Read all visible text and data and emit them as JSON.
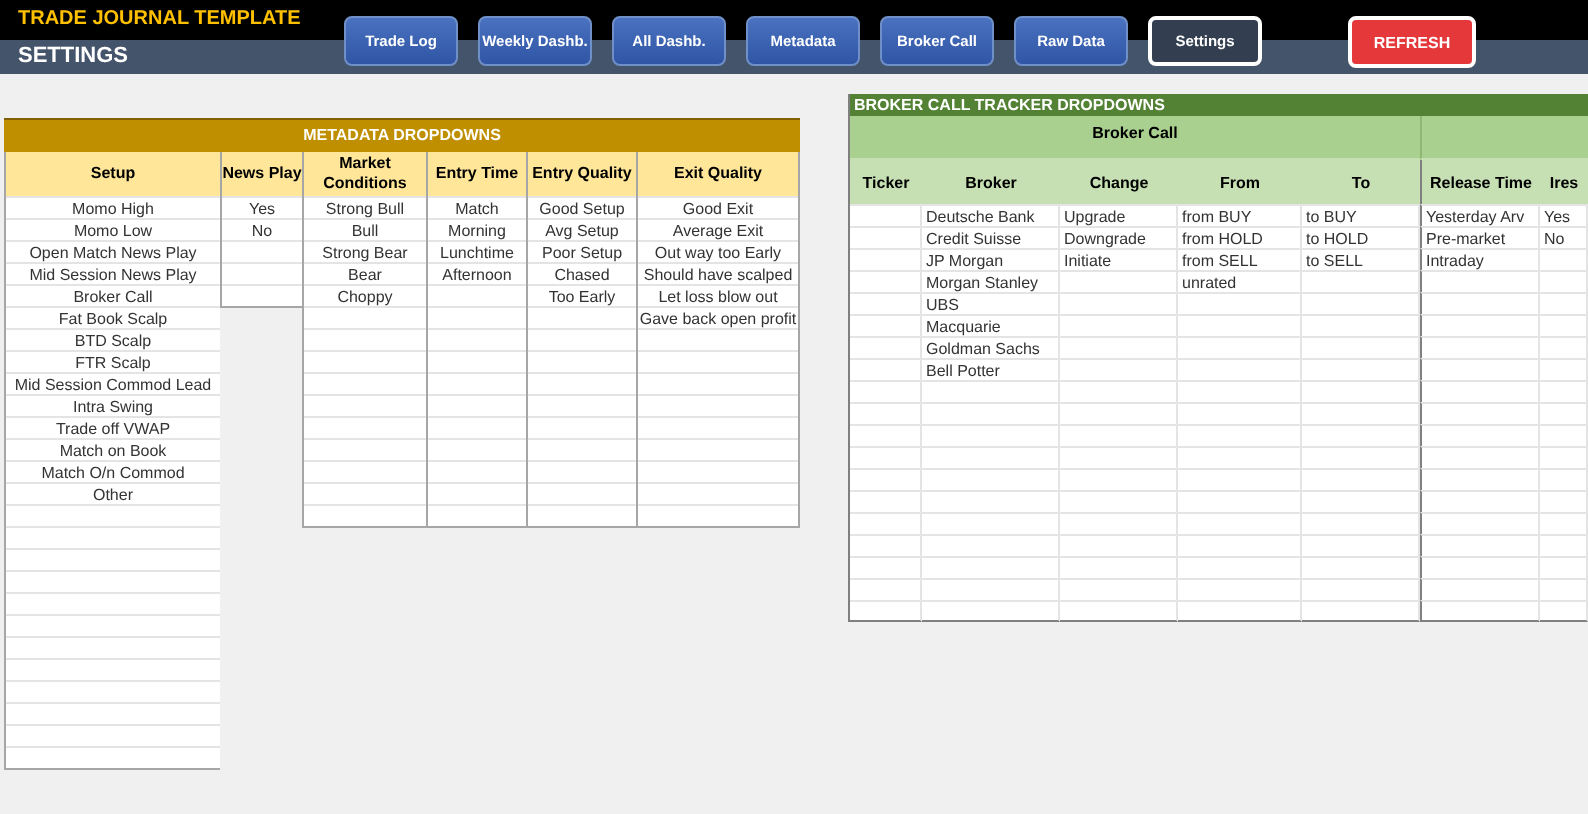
{
  "header": {
    "title": "TRADE JOURNAL TEMPLATE",
    "subtitle": "SETTINGS"
  },
  "nav_buttons": [
    {
      "label": "Trade Log",
      "selected": false
    },
    {
      "label": "Weekly Dashb.",
      "selected": false
    },
    {
      "label": "All Dashb.",
      "selected": false
    },
    {
      "label": "Metadata",
      "selected": false
    },
    {
      "label": "Broker Call",
      "selected": false
    },
    {
      "label": "Raw Data",
      "selected": false
    },
    {
      "label": "Settings",
      "selected": true
    }
  ],
  "refresh_button": {
    "label": "REFRESH"
  },
  "metadata": {
    "title": "METADATA DROPDOWNS",
    "columns": [
      {
        "heading": "Setup",
        "values": [
          "Momo High",
          "Momo Low",
          "Open Match News Play",
          "Mid Session News Play",
          "Broker Call",
          "Fat Book Scalp",
          "BTD Scalp",
          "FTR Scalp",
          "Mid Session Commod Lead",
          "Intra Swing",
          "Trade off VWAP",
          "Match on Book",
          "Match O/n Commod",
          "Other"
        ]
      },
      {
        "heading": "News Play",
        "values": [
          "Yes",
          "No"
        ]
      },
      {
        "heading": "Market Conditions",
        "values": [
          "Strong Bull",
          "Bull",
          "Strong Bear",
          "Bear",
          "Choppy"
        ]
      },
      {
        "heading": "Entry Time",
        "values": [
          "Match",
          "Morning",
          "Lunchtime",
          "Afternoon"
        ]
      },
      {
        "heading": "Entry Quality",
        "values": [
          "Good Setup",
          "Avg Setup",
          "Poor Setup",
          "Chased",
          "Too Early"
        ]
      },
      {
        "heading": "Exit Quality",
        "values": [
          "Good Exit",
          "Average Exit",
          "Out way too Early",
          "Should have scalped",
          "Let loss blow out",
          "Gave back open profit"
        ]
      }
    ]
  },
  "broker_call": {
    "title": "BROKER CALL TRACKER DROPDOWNS",
    "group": {
      "label": "Broker Call",
      "columns": [
        {
          "heading": "Ticker"
        },
        {
          "heading": "Broker",
          "values": [
            "Deutsche Bank",
            "Credit Suisse",
            "JP Morgan",
            "Morgan Stanley",
            "UBS",
            "Macquarie",
            "Goldman Sachs",
            "Bell Potter"
          ]
        },
        {
          "heading": "Change",
          "values": [
            "Upgrade",
            "Downgrade",
            "Initiate"
          ]
        },
        {
          "heading": "From",
          "values": [
            "from BUY",
            "from HOLD",
            "from SELL",
            "unrated"
          ]
        },
        {
          "heading": "To",
          "values": [
            "to BUY",
            "to HOLD",
            "to SELL"
          ]
        }
      ]
    },
    "other_columns": [
      {
        "heading": "Release Time",
        "values": [
          "Yesterday Arv",
          "Pre-market",
          "Intraday"
        ]
      },
      {
        "heading": "Ires",
        "values": [
          "Yes",
          "No"
        ]
      }
    ]
  }
}
